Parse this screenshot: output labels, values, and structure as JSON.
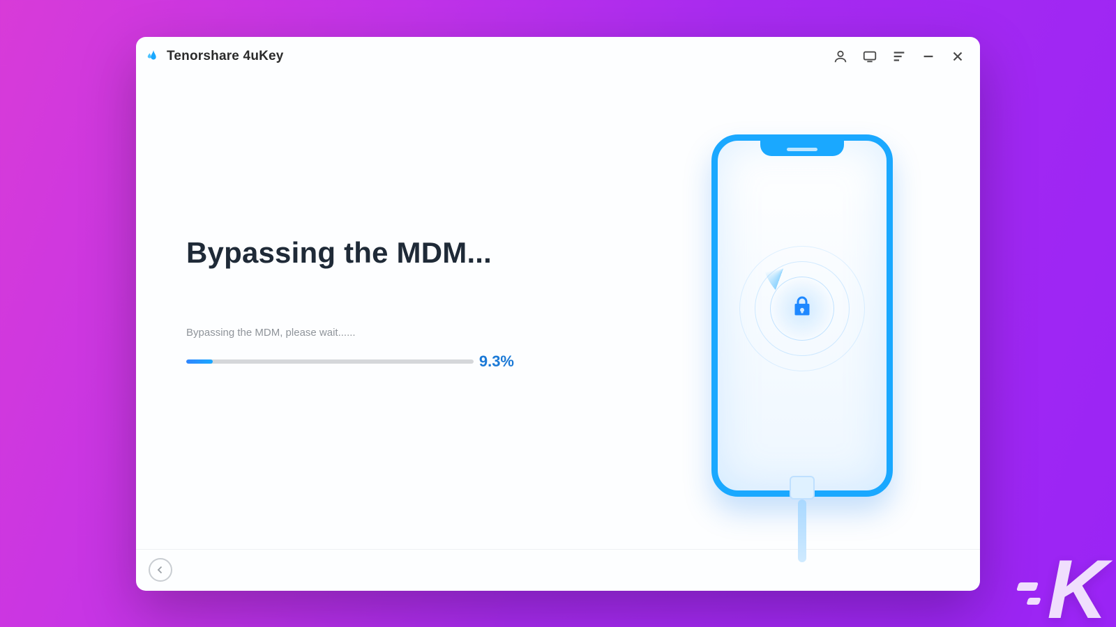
{
  "app": {
    "title": "Tenorshare 4uKey"
  },
  "main": {
    "heading": "Bypassing the MDM...",
    "status_text": "Bypassing the MDM, please wait......",
    "progress_percent_label": "9.3%",
    "progress_percent_value": "9.3"
  },
  "illustration": {
    "device": "iphone",
    "center_icon": "lock-icon"
  },
  "watermark": {
    "letter": "K"
  },
  "colors": {
    "accent": "#1aa8ff",
    "progress_text": "#1b79d6"
  }
}
